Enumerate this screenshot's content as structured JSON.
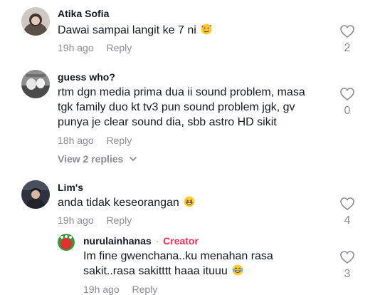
{
  "comments": [
    {
      "username": "Atika Sofia",
      "text": "Dawai sampai langit ke 7 ni",
      "emoji": "smiling-face-with-hearts-emoji",
      "time": "19h ago",
      "reply_label": "Reply",
      "likes": "2"
    },
    {
      "username": "guess who?",
      "text": "rtm dgn media prima dua ii sound problem, masa tgk family duo kt tv3 pun sound problem jgk, gv punya je clear sound dia, sbb astro HD sikit",
      "time": "18h ago",
      "reply_label": "Reply",
      "likes": "0",
      "view_replies": "View 2 replies"
    },
    {
      "username": "Lim's",
      "text": "anda tidak keseorangan",
      "emoji": "grinning-squinting-face-emoji",
      "time": "19h ago",
      "reply_label": "Reply",
      "likes": "4"
    }
  ],
  "reply": {
    "username": "nurulainhanas",
    "separator": "·",
    "creator_label": "Creator",
    "text": "Im fine gwenchana..ku menahan rasa sakit..rasa sakitttt haaa ituuu",
    "emoji": "face-with-tears-of-joy-emoji",
    "time": "19h ago",
    "reply_label": "Reply",
    "likes": "3"
  }
}
